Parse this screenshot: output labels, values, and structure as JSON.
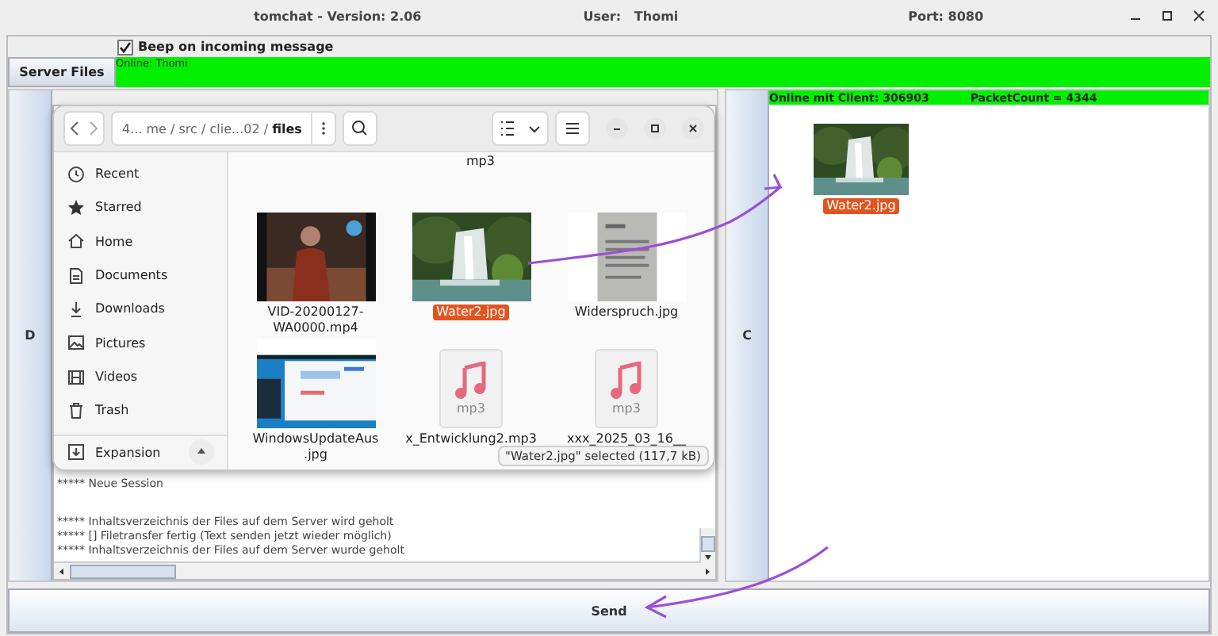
{
  "window": {
    "title": "tomchat - Version: 2.06",
    "user": "User:   Thomi",
    "port": "Port: 8080"
  },
  "beep": {
    "label": "Beep on incoming message",
    "checked": true
  },
  "server_files_button": "Server Files",
  "online_bar": "Online: Thomi",
  "left_panel": {
    "tab": "D",
    "log_blocks": [
      [
        "***** Neue Session"
      ],
      [
        "***** Inhaltsverzeichnis der Files auf dem Server wird geholt",
        "***** [] Filetransfer fertig (Text senden jetzt wieder möglich)",
        "***** Inhaltsverzeichnis der Files auf dem Server wurde geholt"
      ]
    ]
  },
  "right_panel": {
    "tab": "C",
    "status": [
      "Online mit Client: 306903",
      "PacketCount = 4344"
    ],
    "files": [
      {
        "label": [
          "Water2.jpg"
        ],
        "selected": true
      }
    ]
  },
  "file_dialog": {
    "path": "4... me / src / clie...02 / **files**",
    "sidebar": [
      {
        "kind": "recent",
        "label": "Recent"
      },
      {
        "kind": "starred",
        "label": "Starred"
      },
      {
        "kind": "home",
        "label": "Home"
      },
      {
        "kind": "documents",
        "label": "Documents"
      },
      {
        "kind": "downloads",
        "label": "Downloads"
      },
      {
        "kind": "pictures",
        "label": "Pictures"
      },
      {
        "kind": "videos",
        "label": "Videos"
      },
      {
        "kind": "trash",
        "label": "Trash"
      },
      {
        "kind": "drive",
        "label": "Expansion"
      }
    ],
    "top_label": "mp3",
    "files": [
      {
        "kind": "video",
        "label": [
          "VID-20200127-",
          "WA0000.mp4"
        ],
        "selected": false
      },
      {
        "label": [
          "Water2.jpg"
        ],
        "selected": true
      },
      {
        "kind": "scan",
        "label": [
          "Widerspruch.jpg"
        ],
        "selected": false
      },
      {
        "kind": "screenshot",
        "label": [
          "WindowsUpdateAus",
          ".jpg"
        ],
        "selected": false
      },
      {
        "kind": "audio",
        "badge": "mp3",
        "label": [
          "x_Entwicklung2.mp3"
        ],
        "selected": false
      },
      {
        "kind": "audio",
        "badge": "mp3",
        "label": [
          "xxx_2025_03_16__"
        ],
        "selected": false
      }
    ],
    "status": "\"Water2.jpg\" selected  (117,7 kB)"
  },
  "send_button": "Send"
}
